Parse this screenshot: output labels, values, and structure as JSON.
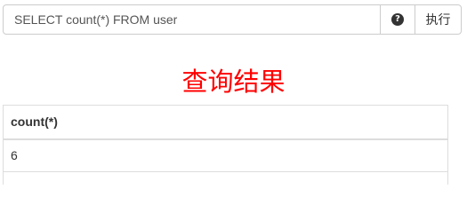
{
  "query": {
    "value": "SELECT count(*) FROM user",
    "help_icon": "question-circle-icon",
    "run_label": "执行"
  },
  "result": {
    "title": "查询结果",
    "columns": [
      "count(*)"
    ],
    "rows": [
      [
        "6"
      ]
    ]
  },
  "colors": {
    "title": "#ff0000",
    "border": "#cccccc",
    "table_border": "#dddddd",
    "text": "#333333"
  }
}
